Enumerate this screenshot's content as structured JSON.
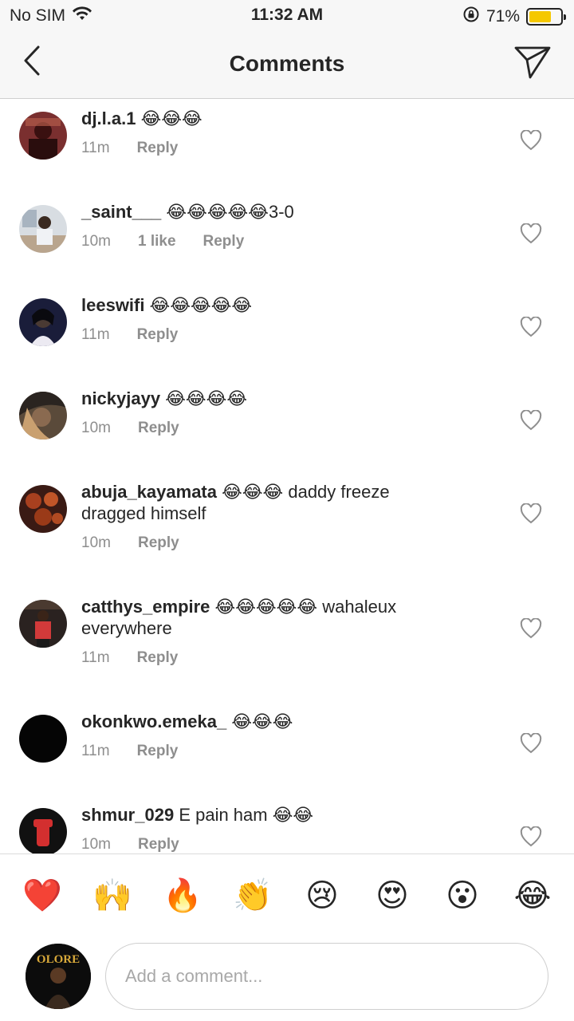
{
  "status_bar": {
    "carrier": "No SIM",
    "time": "11:32 AM",
    "battery": "71%",
    "battery_level": 0.71,
    "battery_color": "#f5c800"
  },
  "nav": {
    "title": "Comments",
    "back_icon": "chevron-left-icon",
    "share_icon": "paper-plane-icon"
  },
  "comments": [
    {
      "user": "dj.l.a.1",
      "text": "😂😂😂",
      "time": "11m",
      "likes": "",
      "reply": "Reply"
    },
    {
      "user": "_saint___",
      "text": "😂😂😂😂😂3-0",
      "time": "10m",
      "likes": "1 like",
      "reply": "Reply"
    },
    {
      "user": "leeswifi",
      "text": "😂😂😂😂😂",
      "time": "11m",
      "likes": "",
      "reply": "Reply"
    },
    {
      "user": "nickyjayy",
      "text": "😂😂😂😂",
      "time": "10m",
      "likes": "",
      "reply": "Reply"
    },
    {
      "user": "abuja_kayamata",
      "text": "😂😂😂 daddy freeze dragged himself",
      "time": "10m",
      "likes": "",
      "reply": "Reply"
    },
    {
      "user": "catthys_empire",
      "text": "😂😂😂😂😂 wahaleux everywhere",
      "time": "11m",
      "likes": "",
      "reply": "Reply"
    },
    {
      "user": "okonkwo.emeka_",
      "text": "😂😂😂",
      "time": "11m",
      "likes": "",
      "reply": "Reply"
    },
    {
      "user": "shmur_029",
      "text": "E pain ham 😂😂",
      "time": "10m",
      "likes": "",
      "reply": "Reply"
    }
  ],
  "emoji_bar": [
    "❤️",
    "🙌",
    "🔥",
    "👏",
    "😢",
    "😍",
    "😮",
    "😂"
  ],
  "composer": {
    "placeholder": "Add a comment...",
    "avatar_text": "OLORE"
  },
  "colors": {
    "text": "#262626",
    "meta": "#8e8e8e",
    "divider": "#dbdbdb"
  }
}
